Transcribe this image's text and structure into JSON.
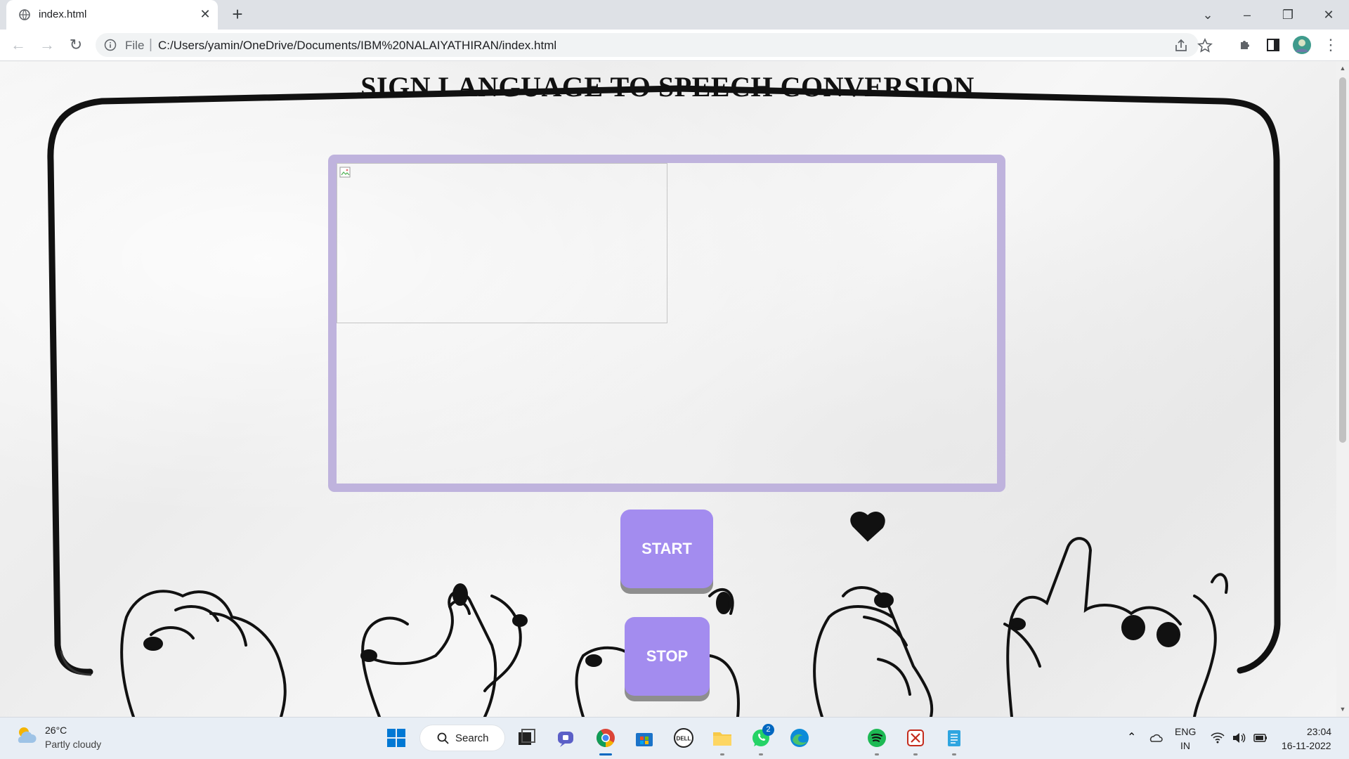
{
  "browser": {
    "tab_title": "index.html",
    "scheme_label": "File",
    "separator": "|",
    "url": "C:/Users/yamin/OneDrive/Documents/IBM%20NALAIYATHIRAN/index.html"
  },
  "page": {
    "title": "SIGN LANGUAGE TO SPEECH CONVERSION",
    "start_label": "START",
    "stop_label": "STOP",
    "accent_color": "#a38cef",
    "frame_color": "#bfb3dd"
  },
  "taskbar": {
    "weather_temp": "26°C",
    "weather_condition": "Partly cloudy",
    "search_label": "Search",
    "whatsapp_badge": "2",
    "lang_primary": "ENG",
    "lang_region": "IN",
    "time": "23:04",
    "date": "16-11-2022"
  }
}
